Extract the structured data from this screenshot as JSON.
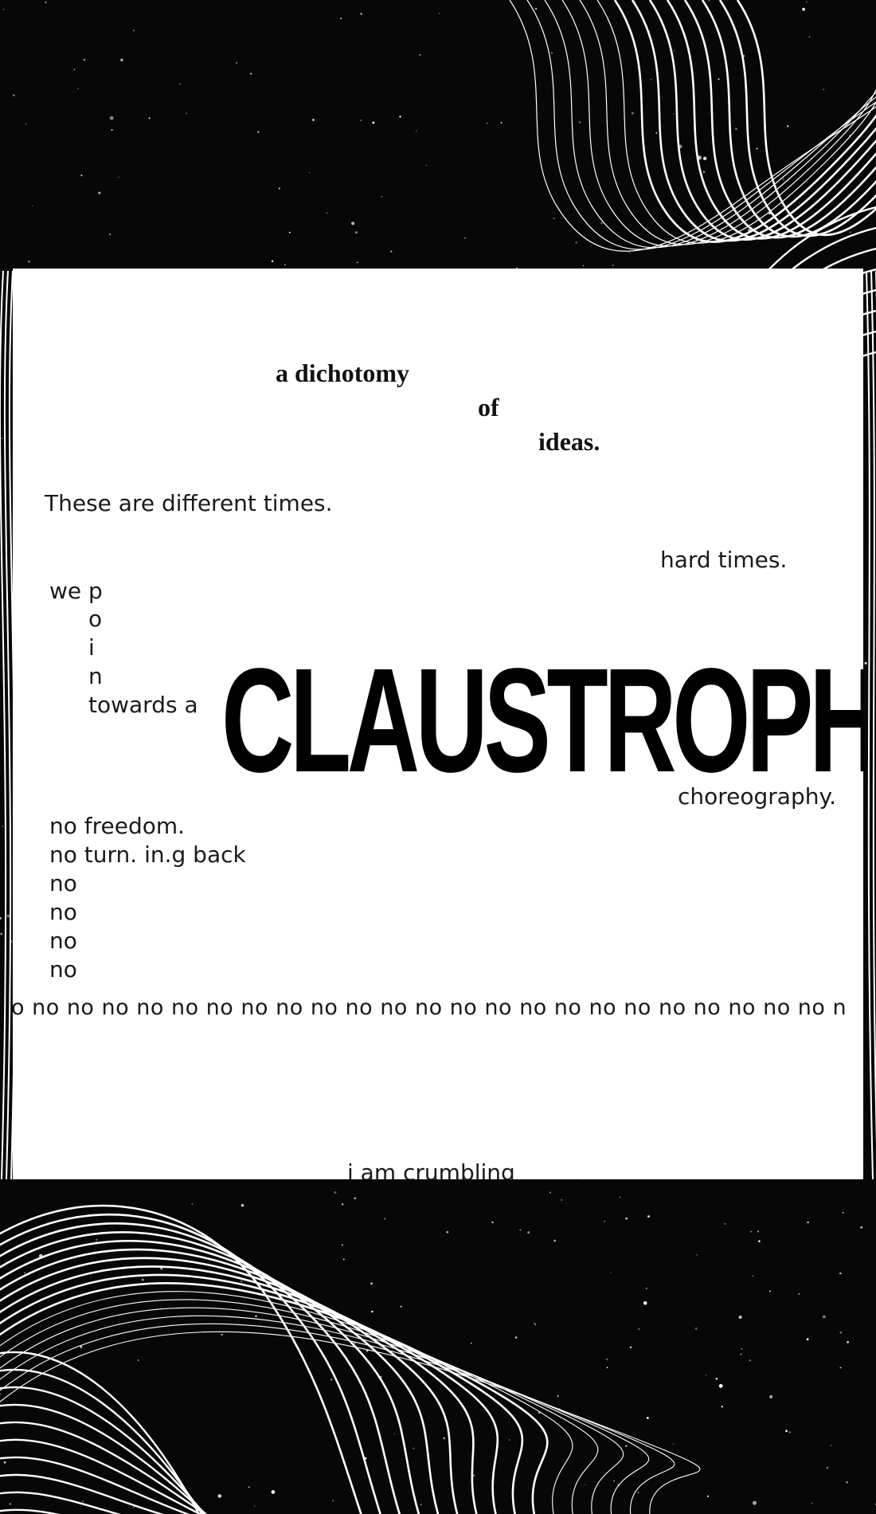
{
  "title_lines": [
    "a dichotomy",
    "of",
    "ideas."
  ],
  "line_different": "These are different times.",
  "line_hard": "hard times.",
  "we": "we",
  "point_letters": [
    "p",
    "o",
    "i",
    "n"
  ],
  "towards": "towards a",
  "big_word": "CLAUSTROPHOBIC",
  "choreography": "choreography.",
  "no_lines": [
    "no freedom.",
    "no turn. in.g back",
    "no",
    "no",
    "no",
    "no"
  ],
  "no_row": "o no no no no no no no no no no no no no no no no no no no no no no no n",
  "crumbling": "i am crumbling",
  "colors": {
    "background": "#070707",
    "card": "#ffffff",
    "lines": "#ffffff",
    "text": "#111111"
  }
}
